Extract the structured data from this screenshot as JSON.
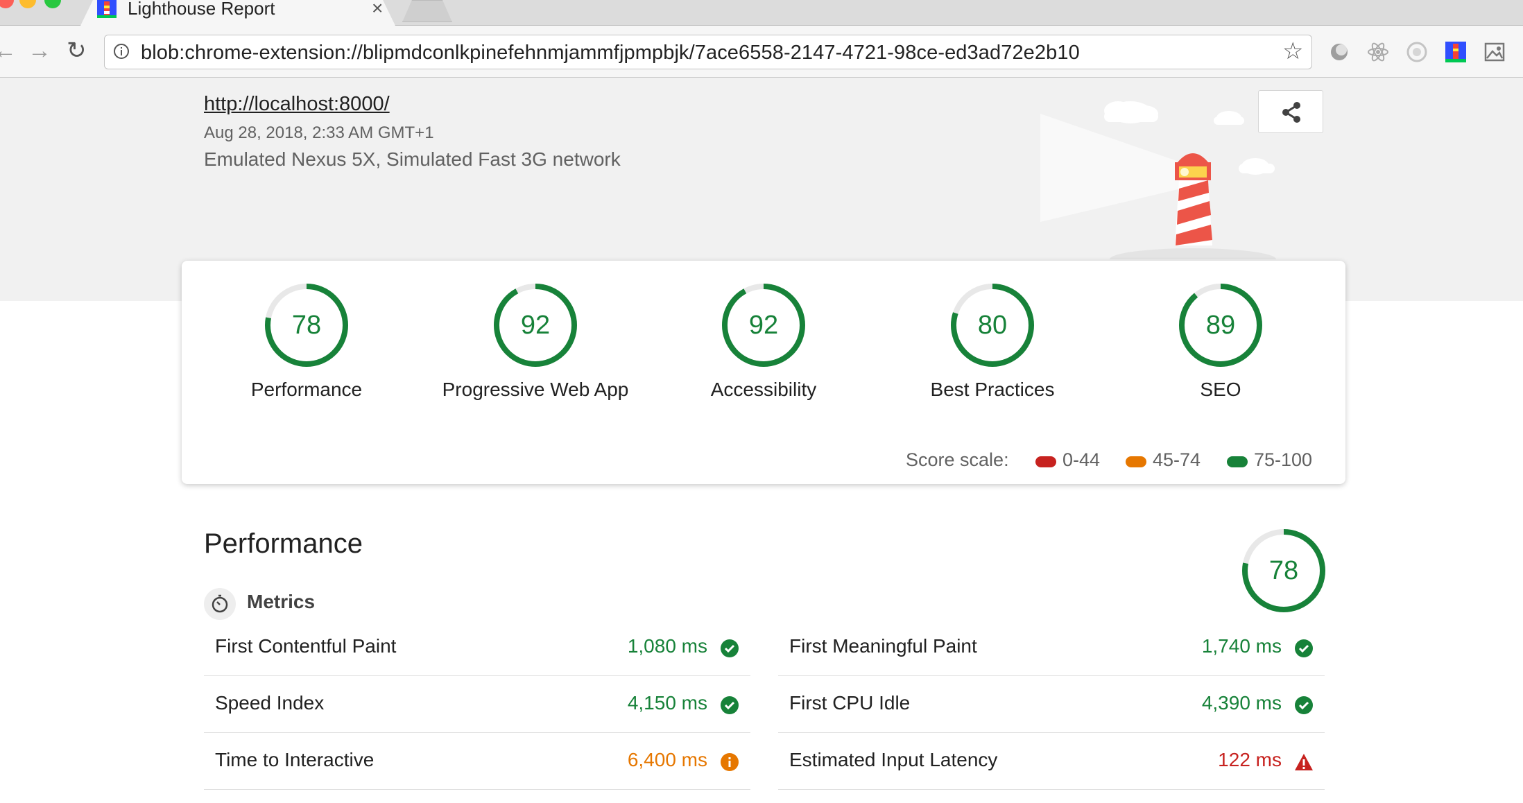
{
  "browser": {
    "tab_title": "Lighthouse Report",
    "tab_close": "×",
    "url": "blob:chrome-extension://blipmdconlkpinefehnmjammfjpmpbjk/7ace6558-2147-4721-98ce-ed3ad72e2b10",
    "star": "☆",
    "back": "←",
    "forward": "→",
    "reload": "↻"
  },
  "report": {
    "url": "http://localhost:8000/",
    "timestamp": "Aug 28, 2018, 2:33 AM GMT+1",
    "environment": "Emulated Nexus 5X, Simulated Fast 3G network"
  },
  "categories": [
    {
      "label": "Performance",
      "score": "78",
      "fraction": 0.78
    },
    {
      "label": "Progressive Web App",
      "score": "92",
      "fraction": 0.92
    },
    {
      "label": "Accessibility",
      "score": "92",
      "fraction": 0.92
    },
    {
      "label": "Best Practices",
      "score": "80",
      "fraction": 0.8
    },
    {
      "label": "SEO",
      "score": "89",
      "fraction": 0.89
    }
  ],
  "score_scale": {
    "label": "Score scale:",
    "ranges": [
      {
        "text": "0-44",
        "color": "#c7221f"
      },
      {
        "text": "45-74",
        "color": "#e67700"
      },
      {
        "text": "75-100",
        "color": "#178239"
      }
    ]
  },
  "performance": {
    "title": "Performance",
    "score": "78",
    "fraction": 0.78,
    "metrics_label": "Metrics",
    "metrics": [
      {
        "name": "First Contentful Paint",
        "value": "1,080 ms",
        "status": "pass"
      },
      {
        "name": "First Meaningful Paint",
        "value": "1,740 ms",
        "status": "pass"
      },
      {
        "name": "Speed Index",
        "value": "4,150 ms",
        "status": "pass"
      },
      {
        "name": "First CPU Idle",
        "value": "4,390 ms",
        "status": "pass"
      },
      {
        "name": "Time to Interactive",
        "value": "6,400 ms",
        "status": "average"
      },
      {
        "name": "Estimated Input Latency",
        "value": "122 ms",
        "status": "fail"
      }
    ]
  },
  "colors": {
    "pass": "#178239",
    "average": "#e67700",
    "fail": "#c7221f"
  }
}
